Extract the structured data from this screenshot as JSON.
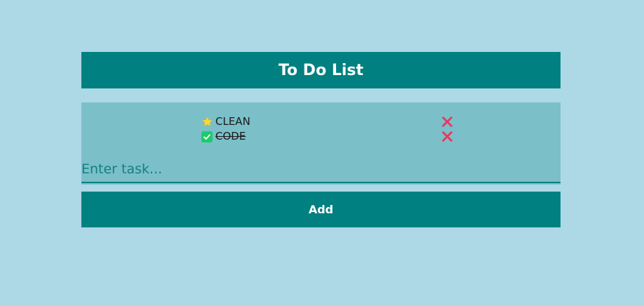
{
  "app": {
    "title": "To Do List"
  },
  "tasks": [
    {
      "label": "CLEAN",
      "done": false,
      "status_icon": "star-icon",
      "delete_icon": "close-icon"
    },
    {
      "label": "CODE",
      "done": true,
      "status_icon": "checkmark-icon",
      "delete_icon": "close-icon"
    }
  ],
  "input": {
    "placeholder": "Enter task...",
    "value": ""
  },
  "add_button": {
    "label": "Add"
  },
  "colors": {
    "background": "#add8e6",
    "primary": "#008080",
    "panel": "#7bbfc9",
    "star": "#fdd835",
    "check": "#1bcc6a",
    "delete": "#e8375f"
  }
}
